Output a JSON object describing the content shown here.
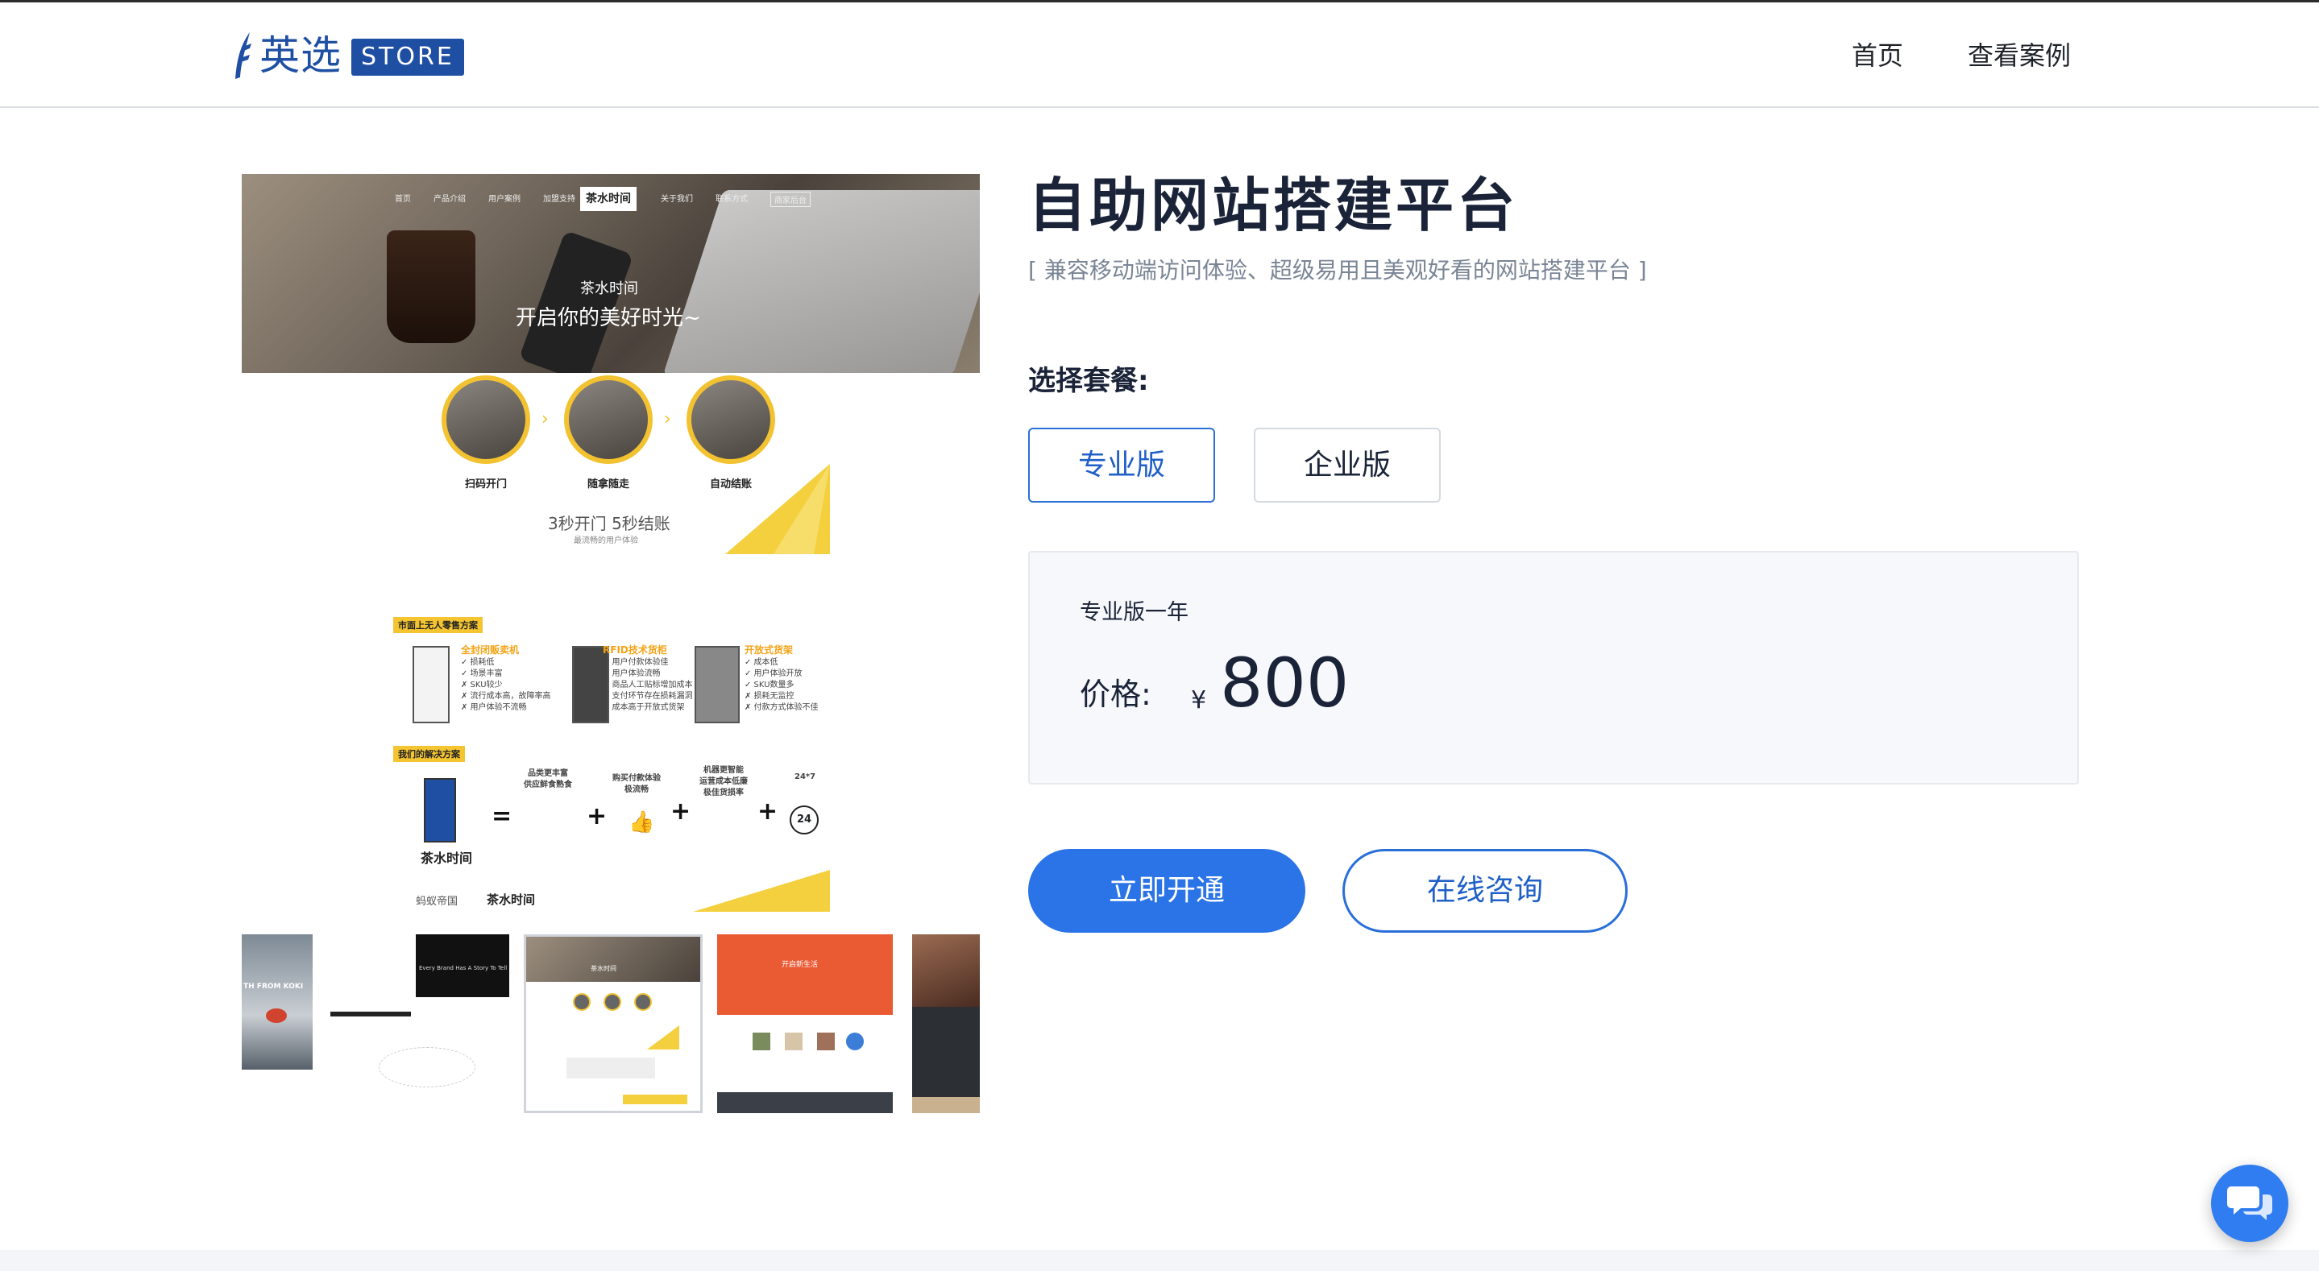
{
  "header": {
    "logo_text": "英选",
    "logo_badge": "STORE",
    "nav": [
      {
        "label": "首页"
      },
      {
        "label": "查看案例"
      }
    ]
  },
  "gallery": {
    "main_preview": {
      "hero_nav": [
        "首页",
        "产品介绍",
        "用户案例",
        "加盟支持",
        "关于我们",
        "联系方式",
        "商家后台"
      ],
      "hero_brand": "茶水时间",
      "hero_line1": "茶水时间",
      "hero_line2": "开启你的美好时光~",
      "steps": [
        "扫码开门",
        "随拿随走",
        "自动结账"
      ],
      "steps_title": "3秒开门 5秒结账",
      "steps_sub": "最流畅的用户体验",
      "market_tag": "市面上无人零售方案",
      "solutions": [
        {
          "title": "全封闭贩卖机",
          "points": "✓ 损耗低\n✓ 场景丰富\n✗ SKU较少\n✗ 流行成本高，故障率高\n✗ 用户体验不流畅"
        },
        {
          "title": "RFID技术货柜",
          "points": "✓ 用户付款体验佳\n✓ 用户体验流畅\n✗ 商品人工贴标增加成本\n✗ 支付环节存在损耗漏洞\n✗ 成本高于开放式货架"
        },
        {
          "title": "开放式货架",
          "points": "✓ 成本低\n✓ 用户体验开放\n✓ SKU数量多\n✗ 损耗无监控\n✗ 付款方式体验不佳"
        }
      ],
      "our_tag": "我们的解决方案",
      "our_brand": "茶水时间",
      "our_items": [
        "品类更丰富\n供应鲜食熟食",
        "购买付款体验\n极流畅",
        "机器更智能\n运营成本低廉\n极佳货损率",
        "24*7"
      ],
      "footer_brands": [
        "蚂蚁帝国",
        "茶水时间"
      ]
    },
    "thumbnails": [
      {
        "caption": "TH FROM KOKI"
      },
      {
        "caption": "Every Brand Has A Story To Tell"
      },
      {
        "caption": "茶水时间"
      },
      {
        "caption": "开启新生活"
      },
      {
        "caption": ""
      }
    ]
  },
  "product": {
    "title": "自助网站搭建平台",
    "subtitle": "[ 兼容移动端访问体验、超级易用且美观好看的网站搭建平台 ]",
    "plan_label": "选择套餐:",
    "plans": [
      {
        "label": "专业版",
        "selected": true
      },
      {
        "label": "企业版",
        "selected": false
      }
    ],
    "price_box": {
      "plan_name": "专业版一年",
      "price_label": "价格:",
      "currency": "¥",
      "price": "800"
    },
    "buy_label": "立即开通",
    "consult_label": "在线咨询"
  },
  "colors": {
    "brand": "#1f4fa3",
    "accent": "#2a74e8",
    "title": "#1a2338",
    "highlight_yellow": "#f4c531"
  },
  "icons": {
    "logo": "feather-icon",
    "chat": "chat-bubbles-icon"
  }
}
